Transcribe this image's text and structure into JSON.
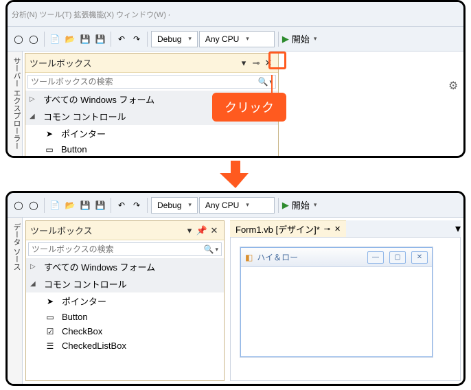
{
  "toolbar": {
    "config_debug": "Debug",
    "config_cpu": "Any CPU",
    "start_label": "開始",
    "menu_hint": "分析(N)   ツール(T)   拡張機能(X)   ウィンドウ(W)   ヘルプ(H)"
  },
  "sidetab": {
    "top_label": "サーバー エクスプローラー",
    "bottom_label": "データ ソース"
  },
  "toolbox": {
    "title": "ツールボックス",
    "search_placeholder": "ツールボックスの検索",
    "groups": {
      "all_forms": "すべての Windows フォーム",
      "common_controls": "コモン コントロール"
    },
    "items": {
      "pointer": "ポインター",
      "button": "Button",
      "checkbox": "CheckBox",
      "checkedlistbox": "CheckedListBox"
    }
  },
  "editor": {
    "tab_label": "Form1.vb [デザイン]*",
    "form_title": "ハイ＆ロー"
  },
  "callout": {
    "label": "クリック"
  }
}
